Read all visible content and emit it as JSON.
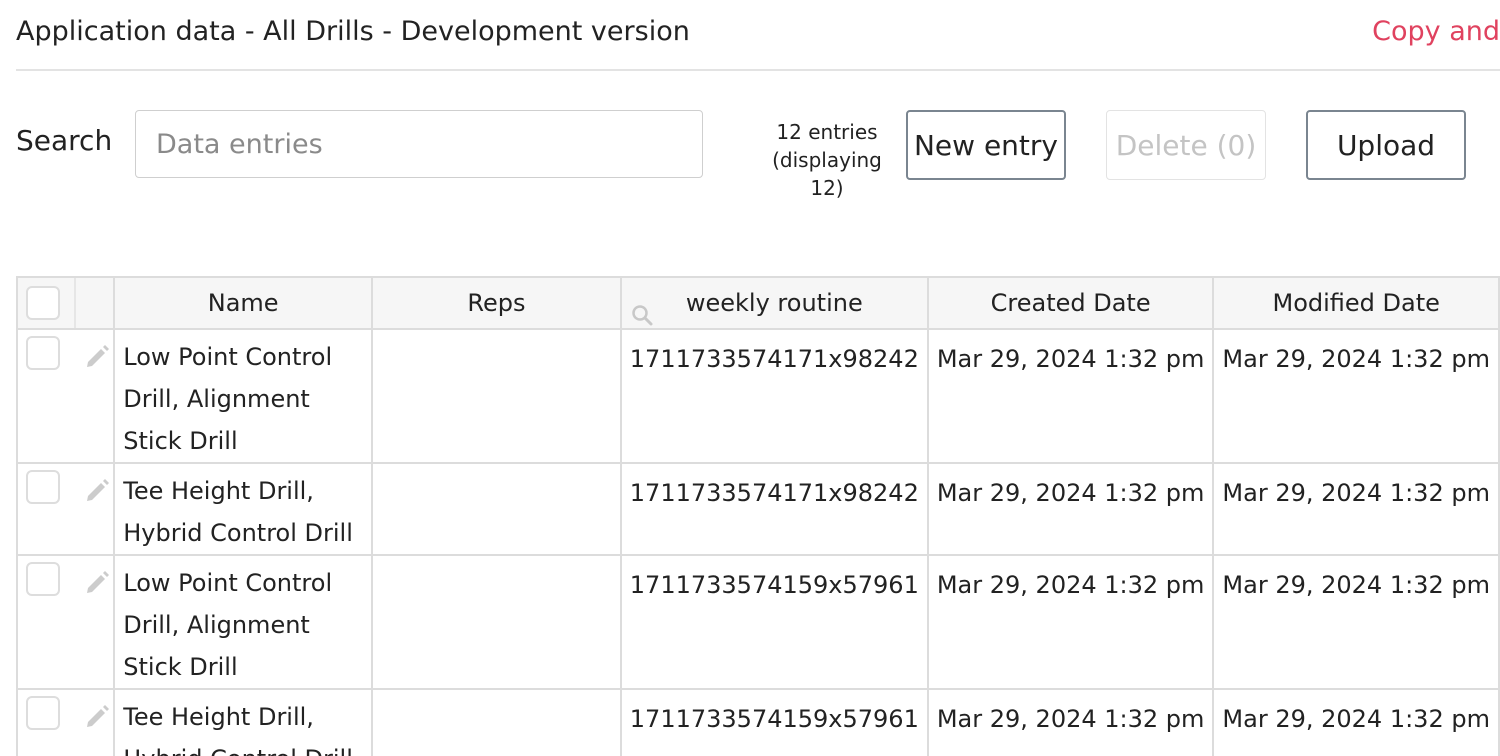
{
  "header": {
    "title": "Application data - All Drills - Development version",
    "copy_link": "Copy and"
  },
  "toolbar": {
    "search_label": "Search",
    "search_placeholder": "Data entries",
    "entries_line1": "12 entries",
    "entries_line2": "(displaying",
    "entries_line3": "12)",
    "new_entry": "New entry",
    "delete": "Delete (0)",
    "upload": "Upload"
  },
  "table": {
    "columns": {
      "name": "Name",
      "reps": "Reps",
      "weekly": "weekly routine",
      "created": "Created Date",
      "modified": "Modified Date"
    },
    "rows": [
      {
        "name": "Low Point Control Drill, Alignment Stick Drill",
        "reps": "",
        "weekly": "1711733574171x98242",
        "created": "Mar 29, 2024 1:32 pm",
        "modified": "Mar 29, 2024 1:32 pm"
      },
      {
        "name": "Tee Height Drill, Hybrid Control Drill",
        "reps": "",
        "weekly": "1711733574171x98242",
        "created": "Mar 29, 2024 1:32 pm",
        "modified": "Mar 29, 2024 1:32 pm"
      },
      {
        "name": "Low Point Control Drill, Alignment Stick Drill",
        "reps": "",
        "weekly": "1711733574159x57961",
        "created": "Mar 29, 2024 1:32 pm",
        "modified": "Mar 29, 2024 1:32 pm"
      },
      {
        "name": "Tee Height Drill, Hybrid Control Drill",
        "reps": "",
        "weekly": "1711733574159x57961",
        "created": "Mar 29, 2024 1:32 pm",
        "modified": "Mar 29, 2024 1:32 pm"
      }
    ]
  },
  "colors": {
    "accent_link": "#e0425f",
    "border": "#dcdcdc",
    "header_bg": "#f6f6f6"
  },
  "icons": {
    "pencil": "pencil-icon",
    "search": "search-icon",
    "checkbox": "checkbox"
  }
}
